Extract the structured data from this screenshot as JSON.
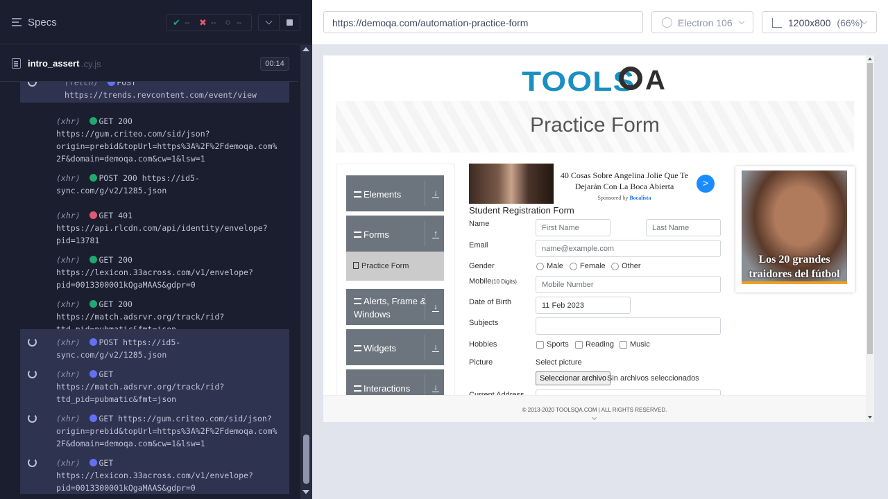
{
  "specs": {
    "title": "Specs"
  },
  "stats": {
    "passed_icon": "✔",
    "passed": "--",
    "failed_icon": "✖",
    "failed": "--",
    "pending_icon": "◌",
    "pending": "--"
  },
  "file": {
    "name": "intro_assert",
    "ext": ".cy.js",
    "duration": "00:14"
  },
  "log": [
    {
      "tag": "(fetch)",
      "status": "pending",
      "method": "POST",
      "line1": "",
      "rest": "https://trends.revcontent.com/event/view"
    },
    {
      "tag": "(xhr)",
      "status": "ok",
      "method": "GET 200",
      "rest": "https://gum.criteo.com/sid/json?\norigin=prebid&topUrl=https%3A%2F%2Fdemoqa.com%\n2F&domain=demoqa.com&cw=1&lsw=1"
    },
    {
      "tag": "(xhr)",
      "status": "ok",
      "method": "POST 200 https://id5-",
      "rest": "sync.com/g/v2/1285.json"
    },
    {
      "tag": "(xhr)",
      "status": "err",
      "method": "GET 401",
      "rest": "https://api.rlcdn.com/api/identity/envelope?\npid=13781"
    },
    {
      "tag": "(xhr)",
      "status": "ok",
      "method": "GET 200",
      "rest": "https://lexicon.33across.com/v1/envelope?\npid=0013300001kQgaMAAS&gdpr=0"
    },
    {
      "tag": "(xhr)",
      "status": "ok",
      "method": "GET 200",
      "rest": "https://match.adsrvr.org/track/rid?\nttd_pid=pubmatic&fmt=json"
    },
    {
      "tag": "(xhr)",
      "status": "pend",
      "method": "POST https://id5-",
      "rest": "sync.com/g/v2/1285.json"
    },
    {
      "tag": "(xhr)",
      "status": "pend",
      "method": "GET",
      "rest": "https://match.adsrvr.org/track/rid?\nttd_pid=pubmatic&fmt=json"
    },
    {
      "tag": "(xhr)",
      "status": "pend",
      "method": "GET https://gum.criteo.com/sid/json?",
      "rest": "origin=prebid&topUrl=https%3A%2F%2Fdemoqa.com%\n2F&domain=demoqa.com&cw=1&lsw=1"
    },
    {
      "tag": "(xhr)",
      "status": "pend",
      "method": "GET",
      "rest": "https://lexicon.33across.com/v1/envelope?\npid=0013300001kQgaMAAS&gdpr=0"
    }
  ],
  "toolbar": {
    "url": "https://demoqa.com/automation-practice-form",
    "browser": "Electron 106",
    "viewport": "1200x800",
    "viewport_pct": "(66%)"
  },
  "site": {
    "logo_text": "TOOLS",
    "logo_a": "A",
    "page_title": "Practice Form",
    "menu": [
      {
        "label": "Elements"
      },
      {
        "label": "Forms"
      },
      {
        "label": "Alerts, Frame &\nWindows"
      },
      {
        "label": "Widgets"
      },
      {
        "label": "Interactions"
      }
    ],
    "sub_active": "Practice Form",
    "ad1": {
      "title": "40 Cosas Sobre Angelina Jolie Que Te Dejarán Con La Boca Abierta",
      "sponsor_prefix": "Sponsored by ",
      "sponsor": "Bocalista",
      "go": ">"
    },
    "form": {
      "title": "Student Registration Form",
      "name_label": "Name",
      "first_name_ph": "First Name",
      "last_name_ph": "Last Name",
      "email_label": "Email",
      "email_ph": "name@example.com",
      "gender_label": "Gender",
      "genders": [
        "Male",
        "Female",
        "Other"
      ],
      "mobile_label": "Mobile",
      "mobile_hint": "(10 Digits)",
      "mobile_ph": "Mobile Number",
      "dob_label": "Date of Birth",
      "dob_value": "11 Feb 2023",
      "subjects_label": "Subjects",
      "hobbies_label": "Hobbies",
      "hobbies": [
        "Sports",
        "Reading",
        "Music"
      ],
      "picture_label": "Picture",
      "select_picture": "Select picture",
      "file_button": "Seleccionar archivo",
      "no_file": "Sin archivos seleccionados",
      "address_label": "Current Address"
    },
    "ad2": {
      "caption": "Los 20 grandes traidores del fútbol"
    },
    "footer": "© 2013-2020 TOOLSQA.COM | ALL RIGHTS RESERVED."
  },
  "colors": {
    "pass": "#1fa971",
    "fail": "#e45770",
    "pending": "#6470f3",
    "menu_bg": "#6c757d"
  }
}
